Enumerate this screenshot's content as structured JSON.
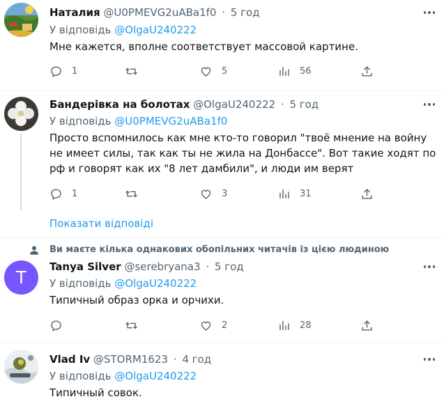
{
  "tweets": [
    {
      "name": "Наталия",
      "handle": "@U0PMEVG2uABa1f0",
      "sep": "·",
      "time": "5 год",
      "reply_prefix": "У відповідь",
      "reply_handle": "@OlgaU240222",
      "text": "Мне кажется, вполне соответствует массовой картине.",
      "replies": "1",
      "retweets": "",
      "likes": "5",
      "views": "56",
      "avatar": "painted-landscape-avatar"
    },
    {
      "name": "Бандерівка на болотах",
      "handle": "@OlgaU240222",
      "sep": "·",
      "time": "5 год",
      "reply_prefix": "У відповідь",
      "reply_handle": "@U0PMEVG2uABa1f0",
      "text": "Просто вспомнилось как мне кто-то говорил \"твоё мнение на войну не имеет силы, так как ты не жила на Донбассе\". Вот такие ходят по рф и говорят как их \"8 лет дамбили\", и люди им верят",
      "replies": "1",
      "retweets": "",
      "likes": "3",
      "views": "31",
      "avatar": "white-flower-avatar"
    },
    {
      "name": "Tanya Silver",
      "handle": "@serebryana3",
      "sep": "·",
      "time": "5 год",
      "reply_prefix": "У відповідь",
      "reply_handle": "@OlgaU240222",
      "text": "Типичный образ орка и орчихи.",
      "replies": "",
      "retweets": "",
      "likes": "2",
      "views": "28",
      "avatar_letter": "T",
      "avatar_color": "#7856ff"
    },
    {
      "name": "Vlad Iv",
      "handle": "@STORM1623",
      "sep": "·",
      "time": "4 год",
      "reply_prefix": "У відповідь",
      "reply_handle": "@OlgaU240222",
      "text": "Типичный совок.",
      "avatar": "winter-photo-avatar"
    }
  ],
  "show_replies": "Показати відповіді",
  "social_context": "Ви маєте кілька однакових обопільних читачів із цією людиною",
  "colors": {
    "accent": "#1d9bf0",
    "muted": "#536471",
    "text": "#0f1419",
    "divider": "#eff3f4"
  }
}
